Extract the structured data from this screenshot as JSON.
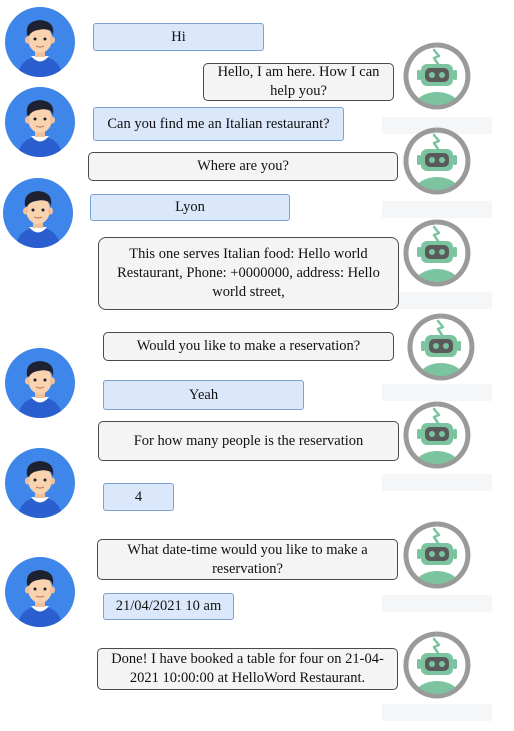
{
  "conversation": {
    "messages": [
      {
        "sender": "user",
        "text": "Hi"
      },
      {
        "sender": "bot",
        "text": "Hello, I am here. How I can help you?"
      },
      {
        "sender": "user",
        "text": "Can you find me an Italian restaurant?"
      },
      {
        "sender": "bot",
        "text": "Where are you?"
      },
      {
        "sender": "user",
        "text": "Lyon"
      },
      {
        "sender": "bot",
        "text": "This one serves Italian food: Hello world Restaurant, Phone: +0000000, address: Hello world street,"
      },
      {
        "sender": "bot",
        "text": "Would you like to make a reservation?"
      },
      {
        "sender": "user",
        "text": "Yeah"
      },
      {
        "sender": "bot",
        "text": "For how many people is the reservation"
      },
      {
        "sender": "user",
        "text": "4"
      },
      {
        "sender": "bot",
        "text": "What date-time would you like to make a reservation?"
      },
      {
        "sender": "user",
        "text": "21/04/2021 10 am"
      },
      {
        "sender": "bot",
        "text": "Done! I have booked a table for four on 21-04-2021 10:00:00 at HelloWord Restaurant."
      }
    ]
  },
  "icons": {
    "user_avatar": "user-avatar-icon",
    "bot_avatar": "robot-avatar-icon"
  },
  "colors": {
    "user_bubble_bg": "#dbe8fb",
    "user_bubble_border": "#7da1d2",
    "bot_bubble_bg": "#f4f4f4",
    "bot_bubble_border": "#4a4a4a",
    "avatar_bg": "#3f86ea",
    "robot_ring": "#9a9a9a",
    "robot_green": "#7cc3a0"
  }
}
